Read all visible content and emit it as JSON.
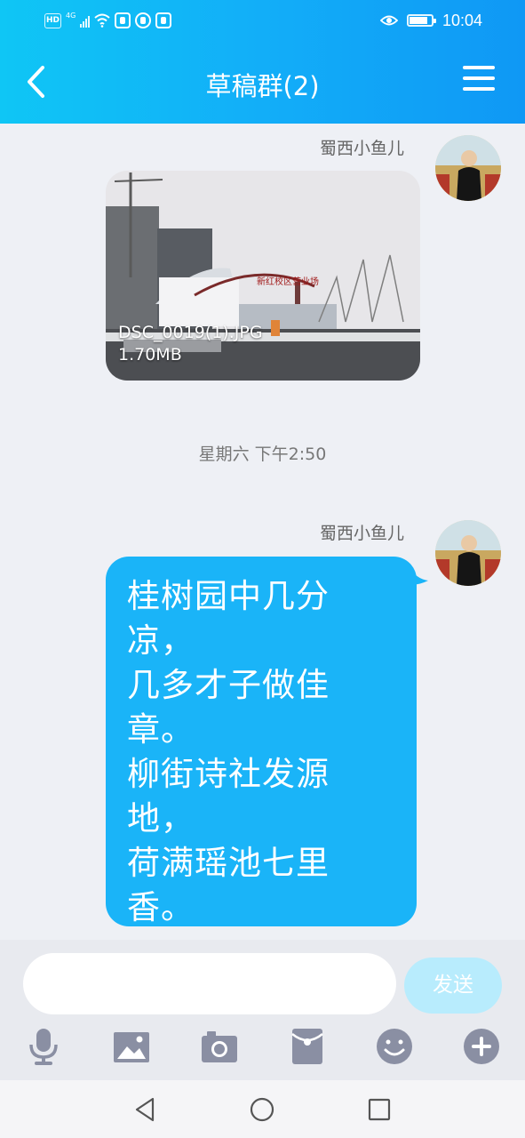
{
  "status_bar": {
    "badge": "HD",
    "network": "4G",
    "time": "10:04"
  },
  "header": {
    "title": "草稿群(2)",
    "back_icon": "chevron-left-icon",
    "menu_icon": "hamburger-menu-icon"
  },
  "messages": [
    {
      "type": "image",
      "sender": "蜀西小鱼儿",
      "file_name": "DSC_0019(1).JPG",
      "file_size": "1.70MB",
      "gate_sign": "新红校区营业场"
    },
    {
      "type": "timestamp",
      "text": "星期六 下午2:50"
    },
    {
      "type": "text",
      "sender": "蜀西小鱼儿",
      "lines": [
        "桂树园中几分",
        "凉，",
        "几多才子做佳",
        "章。",
        "柳街诗社发源",
        "地，",
        "荷满瑶池七里",
        "香。"
      ]
    }
  ],
  "composer": {
    "input_value": "",
    "send_label": "发送",
    "tools": [
      "microphone-icon",
      "image-icon",
      "camera-icon",
      "red-packet-icon",
      "emoji-icon",
      "plus-icon"
    ]
  },
  "colors": {
    "header_start": "#0fc6f5",
    "header_end": "#0f98f5",
    "bubble": "#1ab4f8",
    "send_button": "#b8ecfd",
    "tool_icons": "#8a8fa3"
  },
  "nav_bar": {
    "buttons": [
      "back-triangle-icon",
      "home-circle-icon",
      "recents-square-icon"
    ]
  }
}
